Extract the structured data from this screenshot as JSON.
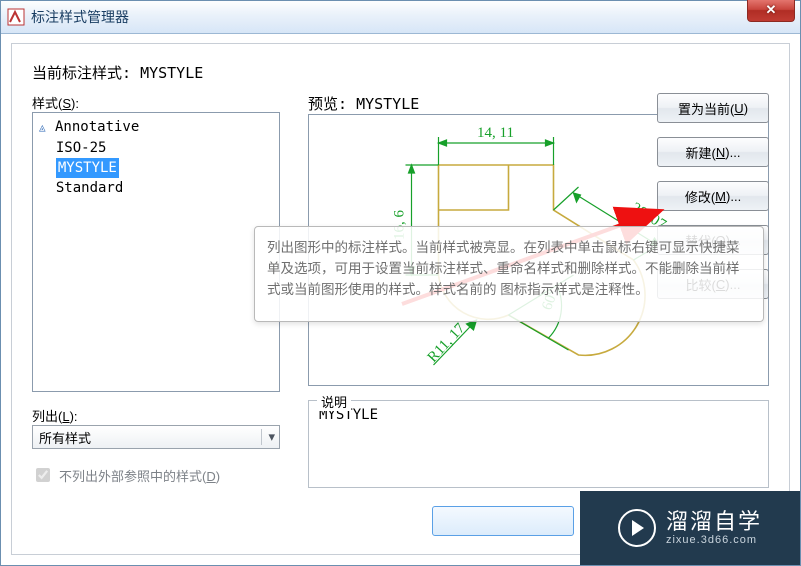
{
  "window": {
    "title": "标注样式管理器",
    "close_glyph": "✕"
  },
  "current_style_label": "当前标注样式: ",
  "current_style_value": "MYSTYLE",
  "styles_label": "样式(",
  "styles_hotkey": "S",
  "styles_label_tail": "):",
  "styles": {
    "items": [
      "Annotative",
      "ISO-25",
      "MYSTYLE",
      "Standard"
    ],
    "selected": "MYSTYLE",
    "annotative_flag_index": 0
  },
  "preview_label": "预览: ",
  "preview_value": "MYSTYLE",
  "preview_dims": {
    "top": "14, 11",
    "left": "16, 6",
    "diag": "28, 07",
    "angle": "60°",
    "radius": "R11, 17"
  },
  "buttons": {
    "set_current": "置为当前(",
    "set_current_k": "U",
    "new_": "新建(",
    "new_k": "N",
    "modify": "修改(",
    "modify_k": "M",
    "override": "替代(",
    "override_k": "O",
    "compare": "比较(",
    "compare_k": "C",
    "tail": ")",
    "ell": "..."
  },
  "list_label": "列出(",
  "list_hotkey": "L",
  "list_tail": "):",
  "list_value": "所有样式",
  "xref_label_a": "不列出外部参照中的样式(",
  "xref_hotkey": "D",
  "xref_tail": ")",
  "xref_checked": true,
  "desc_label": "说明",
  "desc_value": "MYSTYLE",
  "tooltip": "列出图形中的标注样式。当前样式被亮显。在列表中单击鼠标右键可显示快捷菜单及选项，可用于设置当前标注样式、重命名样式和删除样式。不能删除当前样式或当前图形使用的样式。样式名前的 图标指示样式是注释性。",
  "watermark": {
    "brand": "溜溜自学",
    "sub": "zixue.3d66.com"
  }
}
